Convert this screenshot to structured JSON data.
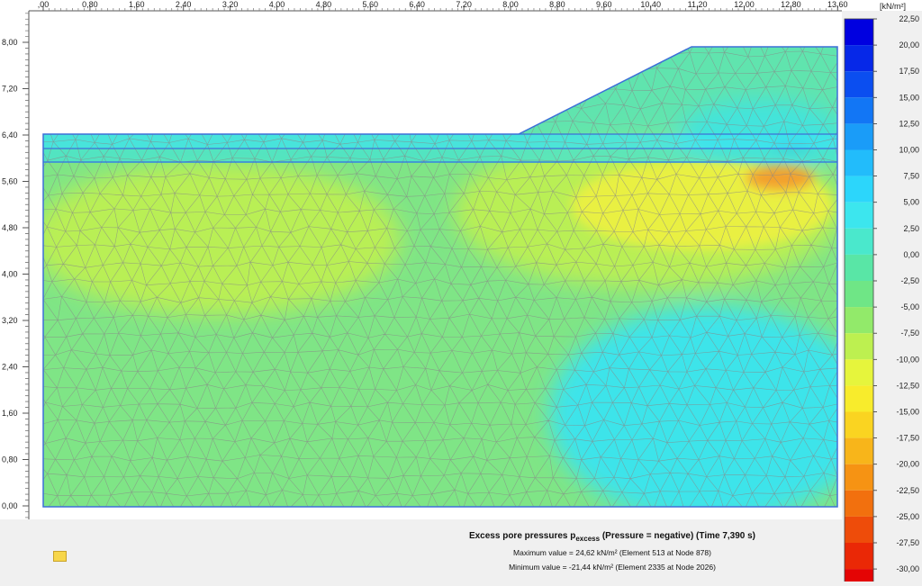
{
  "x_ruler": {
    "ticks": [
      ",00",
      "0,80",
      "1,60",
      "2,40",
      "3,20",
      "4,00",
      "4,80",
      "5,60",
      "6,40",
      "7,20",
      "8,00",
      "8,80",
      "9,60",
      "10,40",
      "11,20",
      "12,00",
      "12,80",
      "13,60"
    ]
  },
  "y_ruler": {
    "ticks": [
      "8,00",
      "7,20",
      "6,40",
      "5,60",
      "4,80",
      "4,00",
      "3,20",
      "2,40",
      "1,60",
      "0,80",
      "0,00"
    ]
  },
  "legend": {
    "unit": "[kN/m²]",
    "labels": [
      "22,50",
      "20,00",
      "17,50",
      "15,00",
      "12,50",
      "10,00",
      "7,50",
      "5,00",
      "2,50",
      "0,00",
      "-2,50",
      "-5,00",
      "-7,50",
      "-10,00",
      "-12,50",
      "-15,00",
      "-17,50",
      "-20,00",
      "-22,50",
      "-25,00",
      "-27,50",
      "-30,00"
    ],
    "colors": [
      "#0000e0",
      "#0628e8",
      "#0b4ef0",
      "#1276f5",
      "#1a9cf8",
      "#22bcfb",
      "#2cd6fb",
      "#3ce6ee",
      "#4ae8cc",
      "#59e6a6",
      "#6fe686",
      "#92ea6a",
      "#bdf050",
      "#e6f53c",
      "#f8ec2c",
      "#fad421",
      "#f8b51a",
      "#f69313",
      "#f2700e",
      "#ee4c0a",
      "#ea2806",
      "#e40404"
    ]
  },
  "info": {
    "title_main": "Excess pore pressures p",
    "title_sub": "excess",
    "title_rest": " (Pressure = negative) (Time 7,390 s)",
    "max_line": "Maximum value = 24,62 kN/m² (Element 513 at Node 878)",
    "min_line": "Minimum value = -21,44 kN/m² (Element 2335 at Node 2026)"
  },
  "plot_colors": {
    "base": "#7fe586",
    "cyan_top": "#3ee4ea",
    "cyan_band": "#47e3cf",
    "yellow_green": "#b9ef55",
    "yellow": "#e9f043",
    "orange": "#f3a02d",
    "blue_spot": "#2aa7f2",
    "mesh": "#888888",
    "boundary": "#3d6fd8"
  }
}
